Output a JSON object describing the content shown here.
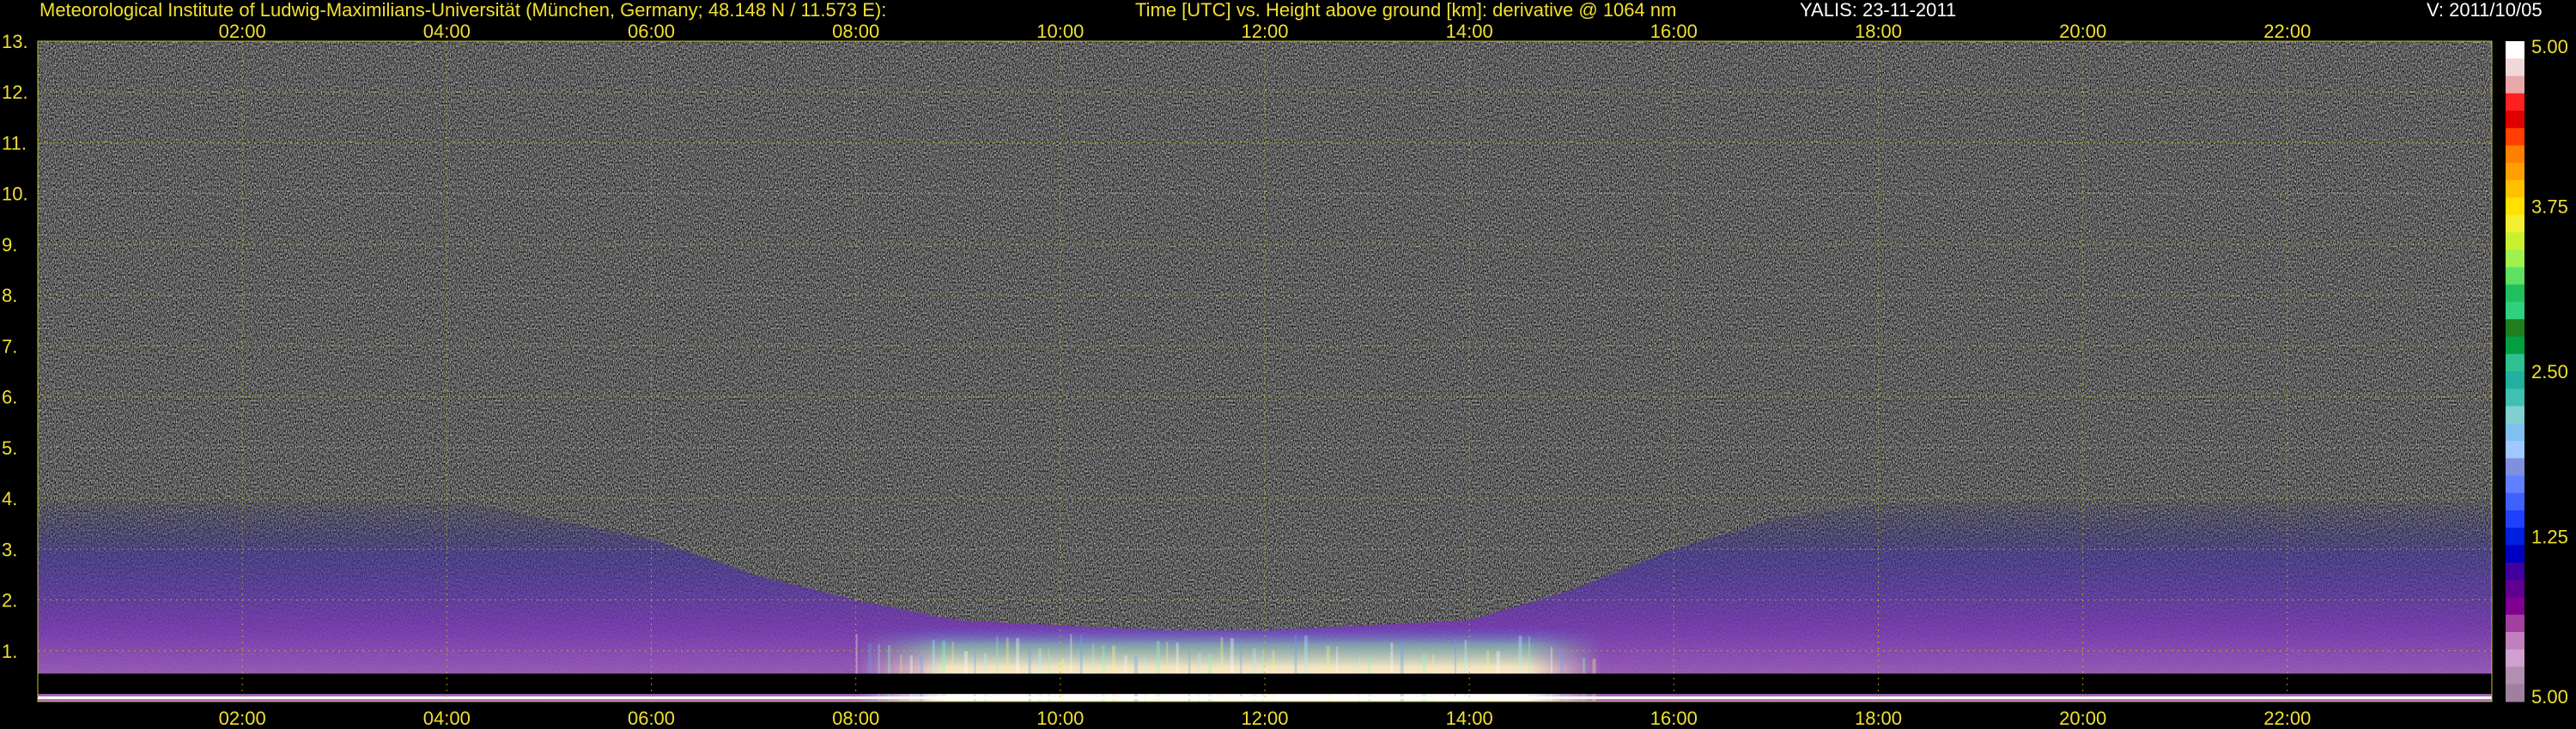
{
  "header": {
    "institute": "Meteorological Institute of Ludwig-Maximilians-Universität (München, Germany; 48.148 N / 11.573 E):",
    "plot_title": "Time [UTC] vs. Height above ground [km]: derivative @ 1064 nm",
    "station_date": "YALIS: 23-11-2011",
    "version": "V: 2011/10/05"
  },
  "colors": {
    "text_yellow": "#f0e030",
    "grid": "#c8c020",
    "background": "#000000"
  },
  "chart_data": {
    "type": "heatmap",
    "title": "Time [UTC] vs. Height above ground [km]: derivative @ 1064 nm",
    "xlabel": "",
    "ylabel": "",
    "xlim": [
      0,
      24
    ],
    "ylim": [
      0,
      13
    ],
    "x_ticks": [
      "02:00",
      "04:00",
      "06:00",
      "08:00",
      "10:00",
      "12:00",
      "14:00",
      "16:00",
      "18:00",
      "20:00",
      "22:00"
    ],
    "x_tick_values": [
      2,
      4,
      6,
      8,
      10,
      12,
      14,
      16,
      18,
      20,
      22
    ],
    "y_ticks": [
      "1.",
      "2.",
      "3.",
      "4.",
      "5.",
      "6.",
      "7.",
      "8.",
      "9.",
      "10.",
      "11.",
      "12.",
      "13."
    ],
    "y_tick_values": [
      1,
      2,
      3,
      4,
      5,
      6,
      7,
      8,
      9,
      10,
      11,
      12,
      13
    ],
    "grid": true,
    "colorbar": {
      "tick_labels": [
        "5.00",
        "3.75",
        "2.50",
        "1.25",
        "5.00"
      ],
      "tick_values": [
        5.0,
        3.75,
        2.5,
        1.25,
        0.0
      ],
      "colors_top_to_bottom": [
        "#ffffff",
        "#f0d8d8",
        "#e8a8a8",
        "#ff2020",
        "#e00000",
        "#ff4000",
        "#ff8000",
        "#ffa000",
        "#ffc000",
        "#ffe000",
        "#f0f030",
        "#c8f030",
        "#a0f050",
        "#60e060",
        "#20c060",
        "#30d080",
        "#208020",
        "#00a040",
        "#30c090",
        "#20b0a0",
        "#40c0b0",
        "#80d0d0",
        "#80c0f0",
        "#a0c8ff",
        "#8090e0",
        "#6080ff",
        "#4060ff",
        "#2040ff",
        "#0020e0",
        "#0000c0",
        "#4000a0",
        "#600090",
        "#800090",
        "#a040a0",
        "#c080c0",
        "#d0a0d0",
        "#b090b0",
        "#a080a0"
      ]
    },
    "structure": {
      "aerosol_top_km_by_hour": [
        [
          0,
          4.0
        ],
        [
          2,
          4.1
        ],
        [
          4,
          4.0
        ],
        [
          6,
          3.2
        ],
        [
          7,
          2.5
        ],
        [
          8,
          2.0
        ],
        [
          9,
          1.6
        ],
        [
          10,
          1.5
        ],
        [
          11,
          1.4
        ],
        [
          12,
          1.4
        ],
        [
          13,
          1.5
        ],
        [
          14,
          1.6
        ],
        [
          15,
          2.2
        ],
        [
          16,
          3.0
        ],
        [
          17,
          3.6
        ],
        [
          18,
          3.9
        ],
        [
          20,
          4.0
        ],
        [
          22,
          4.0
        ],
        [
          24,
          4.0
        ]
      ],
      "bright_layer": {
        "start_h": 8.0,
        "end_h": 15.3,
        "top_km": 1.5
      },
      "ground_black_band_km": [
        0.15,
        0.55
      ]
    }
  }
}
